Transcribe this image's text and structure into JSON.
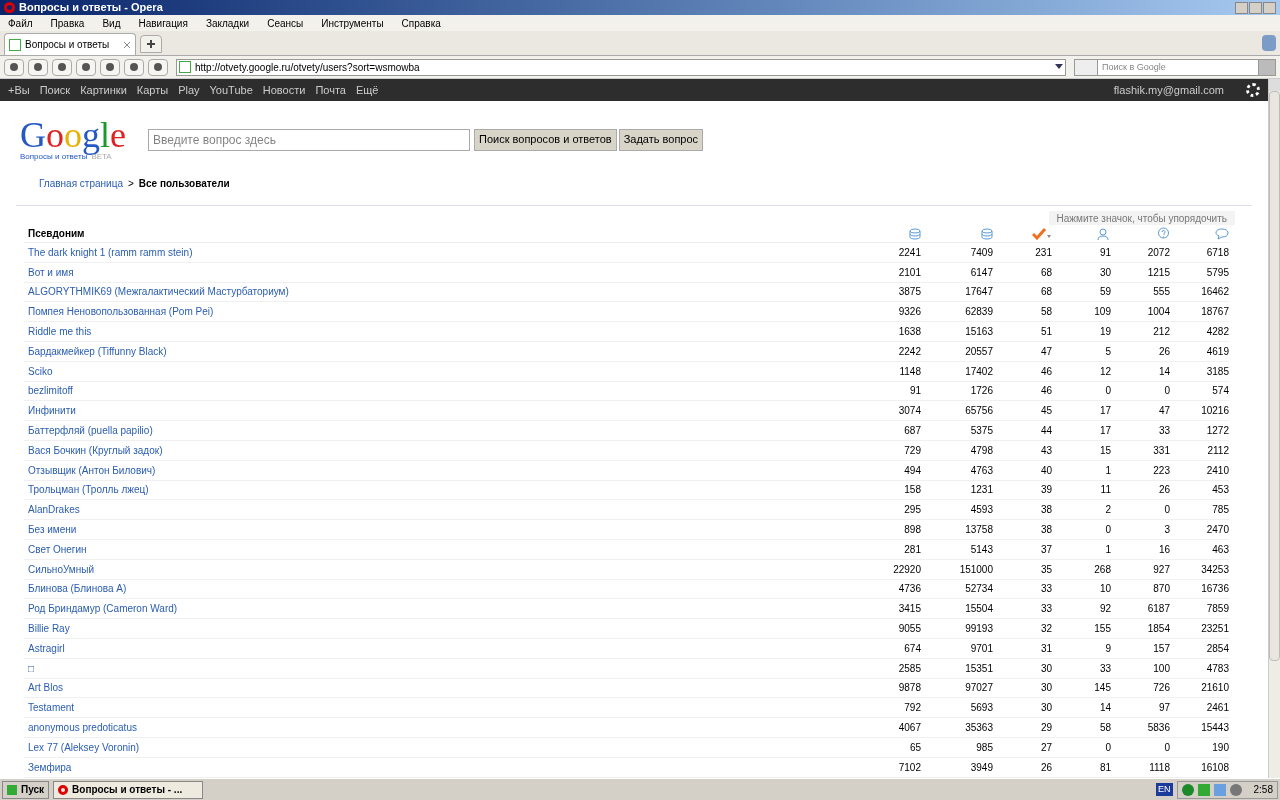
{
  "window": {
    "title": "Вопросы и ответы - Opera"
  },
  "menu": [
    "Файл",
    "Правка",
    "Вид",
    "Навигация",
    "Закладки",
    "Сеансы",
    "Инструменты",
    "Справка"
  ],
  "tabs": [
    {
      "label": "Вопросы и ответы",
      "selected": true
    }
  ],
  "address": {
    "value": "http://otvety.google.ru/otvety/users?sort=wsmowba"
  },
  "search": {
    "placeholder": "Поиск в Google"
  },
  "google_bar": {
    "links": [
      "+Вы",
      "Поиск",
      "Картинки",
      "Карты",
      "Play",
      "YouTube",
      "Новости",
      "Почта",
      "Ещё"
    ],
    "account": "flashik.my@gmail.com"
  },
  "header": {
    "logo": "Google",
    "logo_subtitle": "Вопросы и ответы",
    "logo_badge": "BETA",
    "question_field": {
      "placeholder": "Введите вопрос здесь"
    },
    "buttons": [
      "Поиск вопросов и ответов",
      "Задать вопрос"
    ]
  },
  "breadcrumb": {
    "home": "Главная страница",
    "separator": ">",
    "current": "Все пользователи"
  },
  "table": {
    "sort_hint": "Нажмите значок, чтобы упорядочить",
    "name_header": "Псевдоним",
    "columns": [
      {
        "kind": "stack",
        "selected": false
      },
      {
        "kind": "stack",
        "selected": false
      },
      {
        "kind": "check",
        "selected": true
      },
      {
        "kind": "users",
        "selected": false
      },
      {
        "kind": "question",
        "selected": false
      },
      {
        "kind": "chat",
        "selected": false
      }
    ],
    "rows": [
      {
        "name": "The dark knight 1 (ramm ramm stein)",
        "values": [
          "2241",
          "7409",
          "231",
          "91",
          "2072",
          "6718"
        ]
      },
      {
        "name": "Вот и имя",
        "values": [
          "2101",
          "6147",
          "68",
          "30",
          "1215",
          "5795"
        ]
      },
      {
        "name": "ALGORYTHMIK69 (Межгалактический Мастурбаториум)",
        "values": [
          "3875",
          "17647",
          "68",
          "59",
          "555",
          "16462"
        ]
      },
      {
        "name": "Помпея Неновопользованная (Pom Pei)",
        "values": [
          "9326",
          "62839",
          "58",
          "109",
          "1004",
          "18767"
        ]
      },
      {
        "name": "Riddle me this",
        "values": [
          "1638",
          "15163",
          "51",
          "19",
          "212",
          "4282"
        ]
      },
      {
        "name": "Бардакмейкер (Tiffunny Black)",
        "values": [
          "2242",
          "20557",
          "47",
          "5",
          "26",
          "4619"
        ]
      },
      {
        "name": "Sciko",
        "values": [
          "1148",
          "17402",
          "46",
          "12",
          "14",
          "3185"
        ]
      },
      {
        "name": "bezlimitoff",
        "values": [
          "91",
          "1726",
          "46",
          "0",
          "0",
          "574"
        ]
      },
      {
        "name": "Инфинити",
        "values": [
          "3074",
          "65756",
          "45",
          "17",
          "47",
          "10216"
        ]
      },
      {
        "name": "Баттерфляй (puella papilio)",
        "values": [
          "687",
          "5375",
          "44",
          "17",
          "33",
          "1272"
        ]
      },
      {
        "name": "Вася Бочкин (Круглый задок)",
        "values": [
          "729",
          "4798",
          "43",
          "15",
          "331",
          "2112"
        ]
      },
      {
        "name": "Отзывщик (Антон Билович)",
        "values": [
          "494",
          "4763",
          "40",
          "1",
          "223",
          "2410"
        ]
      },
      {
        "name": "Трольцман (Тролль лжец)",
        "values": [
          "158",
          "1231",
          "39",
          "11",
          "26",
          "453"
        ]
      },
      {
        "name": "AlanDrakes",
        "values": [
          "295",
          "4593",
          "38",
          "2",
          "0",
          "785"
        ]
      },
      {
        "name": "Без имени",
        "values": [
          "898",
          "13758",
          "38",
          "0",
          "3",
          "2470"
        ]
      },
      {
        "name": "Свет Онегин",
        "values": [
          "281",
          "5143",
          "37",
          "1",
          "16",
          "463"
        ]
      },
      {
        "name": "СильноУмный",
        "values": [
          "22920",
          "151000",
          "35",
          "268",
          "927",
          "34253"
        ]
      },
      {
        "name": "Блинова (Блинова А)",
        "values": [
          "4736",
          "52734",
          "33",
          "10",
          "870",
          "16736"
        ]
      },
      {
        "name": "Род Бриндамур (Cameron Ward)",
        "values": [
          "3415",
          "15504",
          "33",
          "92",
          "6187",
          "7859"
        ]
      },
      {
        "name": "Billie Ray",
        "values": [
          "9055",
          "99193",
          "32",
          "155",
          "1854",
          "23251"
        ]
      },
      {
        "name": "Astragirl",
        "values": [
          "674",
          "9701",
          "31",
          "9",
          "157",
          "2854"
        ]
      },
      {
        "name": "□",
        "values": [
          "2585",
          "15351",
          "30",
          "33",
          "100",
          "4783"
        ]
      },
      {
        "name": "Art Blos",
        "values": [
          "9878",
          "97027",
          "30",
          "145",
          "726",
          "21610"
        ]
      },
      {
        "name": "Testament",
        "values": [
          "792",
          "5693",
          "30",
          "14",
          "97",
          "2461"
        ]
      },
      {
        "name": "anonymous predoticatus",
        "values": [
          "4067",
          "35363",
          "29",
          "58",
          "5836",
          "15443"
        ]
      },
      {
        "name": "Lex 77 (Aleksey Voronin)",
        "values": [
          "65",
          "985",
          "27",
          "0",
          "0",
          "190"
        ]
      },
      {
        "name": "Земфира",
        "values": [
          "7102",
          "3949",
          "26",
          "81",
          "1118",
          "16108"
        ]
      }
    ]
  },
  "taskbar": {
    "start": "Пуск",
    "task": "Вопросы и ответы - ...",
    "lang": "EN",
    "clock": "2:58"
  }
}
